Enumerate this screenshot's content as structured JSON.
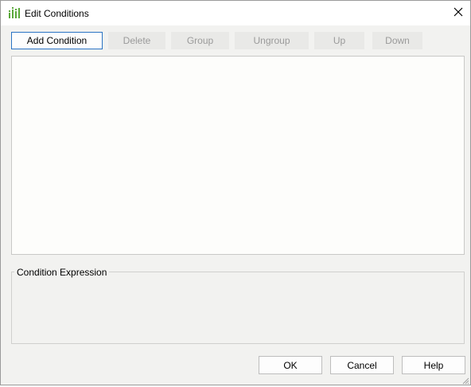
{
  "window": {
    "title": "Edit Conditions",
    "app_icon": "bar-chart-icon",
    "close_icon": "close-icon",
    "close_glyph": "✕"
  },
  "toolbar": {
    "add_condition": "Add Condition",
    "delete": "Delete",
    "group": "Group",
    "ungroup": "Ungroup",
    "up": "Up",
    "down": "Down"
  },
  "expression": {
    "label": "Condition Expression"
  },
  "footer": {
    "ok": "OK",
    "cancel": "Cancel",
    "help": "Help"
  },
  "colors": {
    "accent": "#2b74c4",
    "icon_green": "#5aa83a",
    "disabled_text": "#9a9a9a"
  }
}
